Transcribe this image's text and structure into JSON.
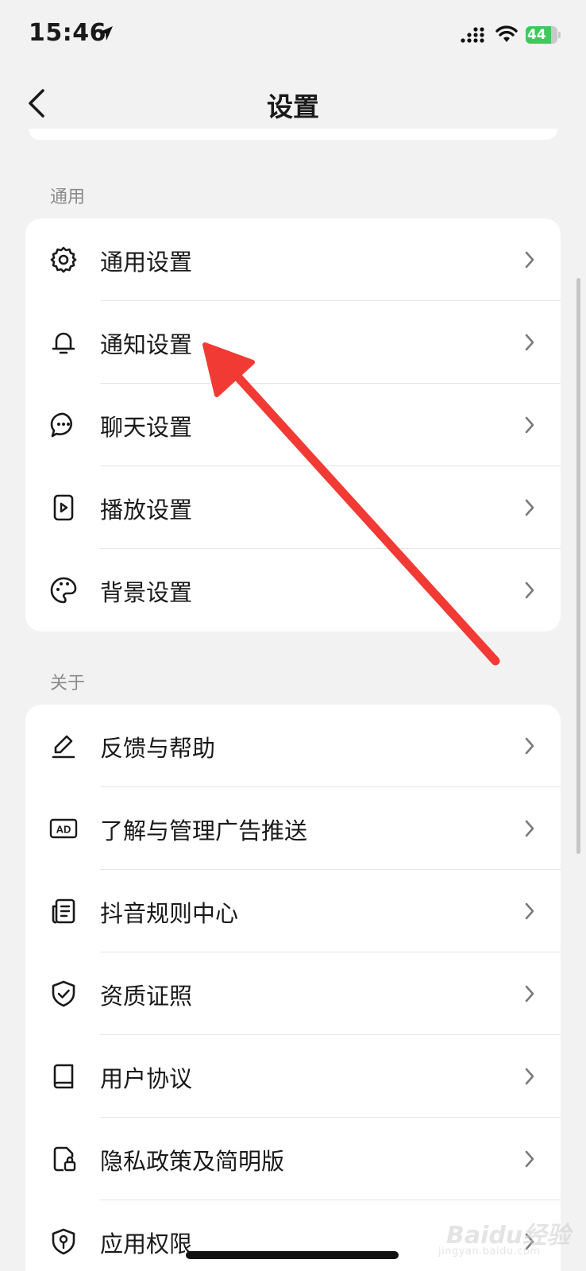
{
  "status_bar": {
    "time": "15:46",
    "battery": "44"
  },
  "nav": {
    "title": "设置"
  },
  "sections": [
    {
      "label": "通用",
      "items": [
        {
          "label": "通用设置",
          "icon": "gear-icon"
        },
        {
          "label": "通知设置",
          "icon": "bell-icon"
        },
        {
          "label": "聊天设置",
          "icon": "chat-bubble-icon"
        },
        {
          "label": "播放设置",
          "icon": "play-icon"
        },
        {
          "label": "背景设置",
          "icon": "palette-icon"
        }
      ]
    },
    {
      "label": "关于",
      "items": [
        {
          "label": "反馈与帮助",
          "icon": "pencil-icon"
        },
        {
          "label": "了解与管理广告推送",
          "icon": "ad-icon"
        },
        {
          "label": "抖音规则中心",
          "icon": "document-list-icon"
        },
        {
          "label": "资质证照",
          "icon": "shield-check-icon"
        },
        {
          "label": "用户协议",
          "icon": "book-icon"
        },
        {
          "label": "隐私政策及简明版",
          "icon": "lock-document-icon"
        },
        {
          "label": "应用权限",
          "icon": "shield-key-icon"
        }
      ]
    }
  ],
  "colors": {
    "background": "#f2f2f2",
    "card": "#ffffff",
    "annotation_arrow": "#f23a35"
  },
  "watermark": {
    "brand": "Baidu经验",
    "sub": "jingyan.baidu.com"
  }
}
